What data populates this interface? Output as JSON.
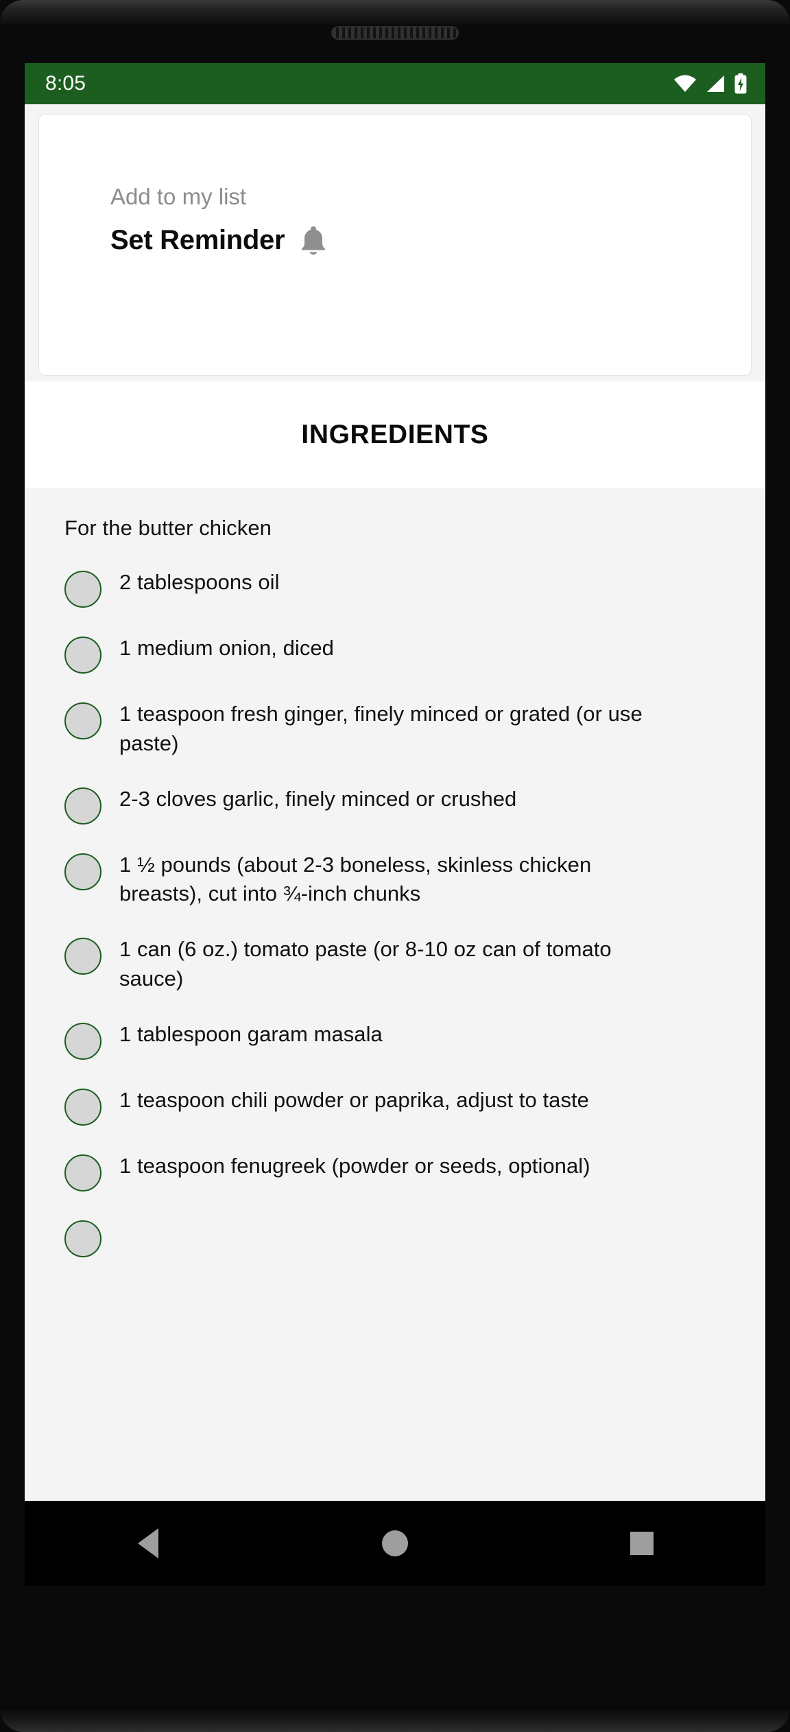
{
  "status_bar": {
    "time": "8:05",
    "background_color": "#1b5e20",
    "icons": [
      "wifi-icon",
      "cellular-signal-icon",
      "battery-charging-icon"
    ]
  },
  "reminder_card": {
    "subtitle": "Add to my list",
    "title": "Set Reminder",
    "icon": "bell-icon"
  },
  "ingredients": {
    "header": "INGREDIENTS",
    "section_title": "For the butter chicken",
    "items": [
      {
        "text": "2 tablespoons oil",
        "checked": false
      },
      {
        "text": "1 medium onion, diced",
        "checked": false
      },
      {
        "text": "1 teaspoon fresh ginger, finely minced or grated (or use paste)",
        "checked": false
      },
      {
        "text": "2-3 cloves garlic, finely minced or crushed",
        "checked": false
      },
      {
        "text": "1 ½ pounds (about 2-3 boneless, skinless chicken breasts), cut into ¾-inch chunks",
        "checked": false
      },
      {
        "text": "1 can (6 oz.) tomato paste (or 8-10 oz can of tomato sauce)",
        "checked": false
      },
      {
        "text": "1 tablespoon garam masala",
        "checked": false
      },
      {
        "text": "1 teaspoon chili powder or paprika, adjust to taste",
        "checked": false
      },
      {
        "text": "1 teaspoon fenugreek (powder or seeds, optional)",
        "checked": false
      }
    ]
  },
  "nav_bar": {
    "back": "back-button",
    "home": "home-button",
    "recents": "recents-button"
  },
  "theme": {
    "accent_green": "#1b5e20",
    "page_background": "#f4f4f4",
    "card_background": "#ffffff",
    "checkbox_fill": "#d6d6d6",
    "muted_text": "#8c8c8c"
  }
}
